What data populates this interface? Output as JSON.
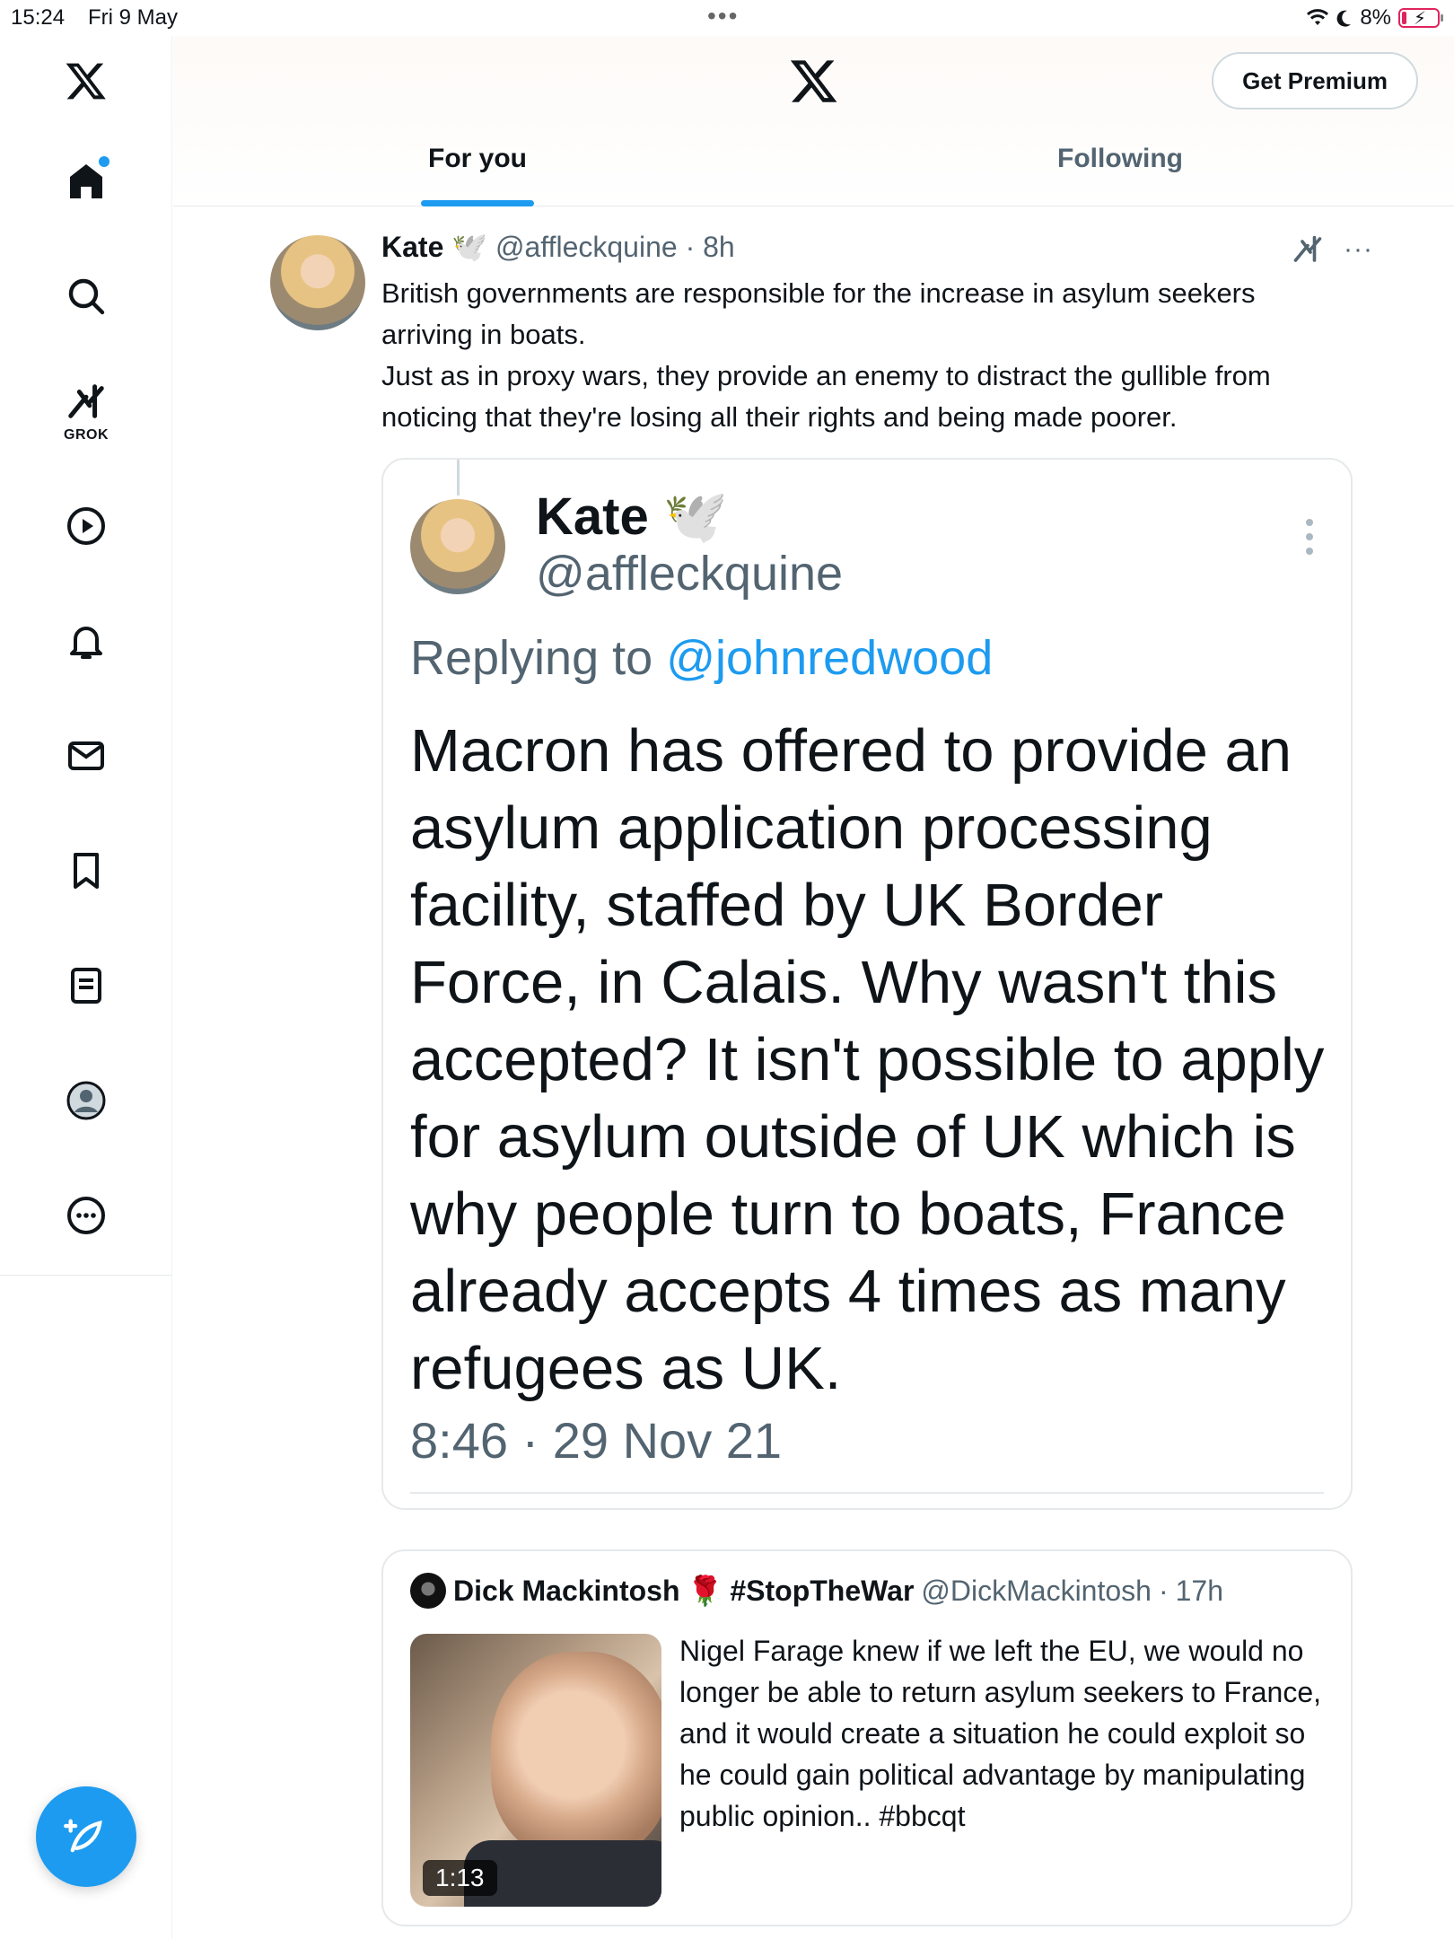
{
  "status_bar": {
    "time": "15:24",
    "date": "Fri 9 May",
    "battery": "8%"
  },
  "sidebar": {
    "items": [
      {
        "icon": "x-logo-icon"
      },
      {
        "icon": "home-icon"
      },
      {
        "icon": "search-icon"
      },
      {
        "icon": "grok-icon",
        "label": "GROK"
      },
      {
        "icon": "play-icon"
      },
      {
        "icon": "bell-icon"
      },
      {
        "icon": "mail-icon"
      },
      {
        "icon": "bookmark-icon"
      },
      {
        "icon": "list-icon"
      },
      {
        "icon": "profile-icon"
      },
      {
        "icon": "more-icon"
      }
    ],
    "compose_icon": "compose-icon"
  },
  "header": {
    "premium_label": "Get Premium",
    "tabs": [
      {
        "label": "For you",
        "active": true
      },
      {
        "label": "Following",
        "active": false
      }
    ]
  },
  "tweet": {
    "name": "Kate",
    "badge": "🕊️",
    "handle": "@affleckquine",
    "time": "8h",
    "text_lines": [
      "British governments are responsible for the increase in asylum seekers arriving in boats.",
      "Just as in proxy wars, they provide an enemy to distract the gullible from noticing that they're losing all their rights and being made poorer."
    ],
    "image_quote": {
      "name": "Kate",
      "badge": "🕊️",
      "handle": "@affleckquine",
      "replying_prefix": "Replying to",
      "replying_to": "@johnredwood",
      "body": "Macron has offered to provide an asylum application processing facility, staffed by UK Border Force, in Calais. Why wasn't this accepted? It isn't possible to apply for asylum outside of UK which is why people turn to boats, France already accepts 4 times as many refugees as UK.",
      "timestamp": "8:46 · 29 Nov 21"
    },
    "quoted_tweet": {
      "name": "Dick Mackintosh",
      "name_emoji": "🌹",
      "name_suffix": "#StopTheWar",
      "handle": "@DickMackintosh",
      "time": "17h",
      "text": "Nigel Farage knew if we left the EU, we would no longer be able to return asylum seekers to France, and it would create a situation he could exploit so he could gain political advantage by manipulating public opinion.. #bbcqt",
      "video_duration": "1:13"
    }
  },
  "colors": {
    "accent": "#1d9bf0",
    "text": "#0f1419",
    "muted": "#536471",
    "border": "#e6e9eb",
    "battery_low": "#e0245e"
  }
}
